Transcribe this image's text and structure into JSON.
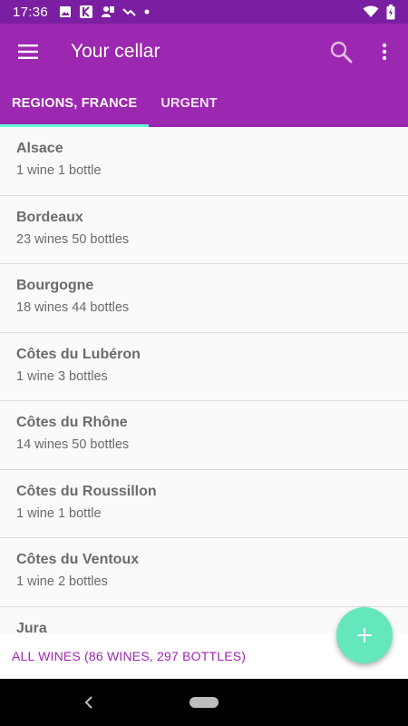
{
  "status_bar": {
    "time": "17:36",
    "left_icons": [
      "image-icon",
      "k-app-icon",
      "contact-icon",
      "missed-call-icon",
      "dot-icon"
    ],
    "right_icons": [
      "wifi-icon",
      "battery-icon"
    ]
  },
  "app_bar": {
    "title": "Your cellar",
    "icons": [
      "menu-icon",
      "search-icon",
      "more-vert-icon"
    ]
  },
  "tabs": [
    {
      "label": "REGIONS, FRANCE",
      "active": true
    },
    {
      "label": "URGENT",
      "active": false
    }
  ],
  "regions": [
    {
      "name": "Alsace",
      "count": "1 wine 1 bottle"
    },
    {
      "name": "Bordeaux",
      "count": "23 wines 50 bottles"
    },
    {
      "name": "Bourgogne",
      "count": "18 wines 44 bottles"
    },
    {
      "name": "Côtes du Lubéron",
      "count": "1 wine 3 bottles"
    },
    {
      "name": "Côtes du Rhône",
      "count": "14 wines 50 bottles"
    },
    {
      "name": "Côtes du Roussillon",
      "count": "1 wine 1 bottle"
    },
    {
      "name": "Côtes du Ventoux",
      "count": "1 wine 2 bottles"
    },
    {
      "name": "Jura",
      "count": ""
    }
  ],
  "footer": {
    "all_wines": "ALL WINES (86 WINES, 297 BOTTLES)"
  },
  "fab": {
    "icon": "add-icon"
  },
  "colors": {
    "primary": "#9c27b0",
    "primary_dark": "#7b1fa2",
    "accent": "#64ffda",
    "fab": "#64e7bd"
  }
}
